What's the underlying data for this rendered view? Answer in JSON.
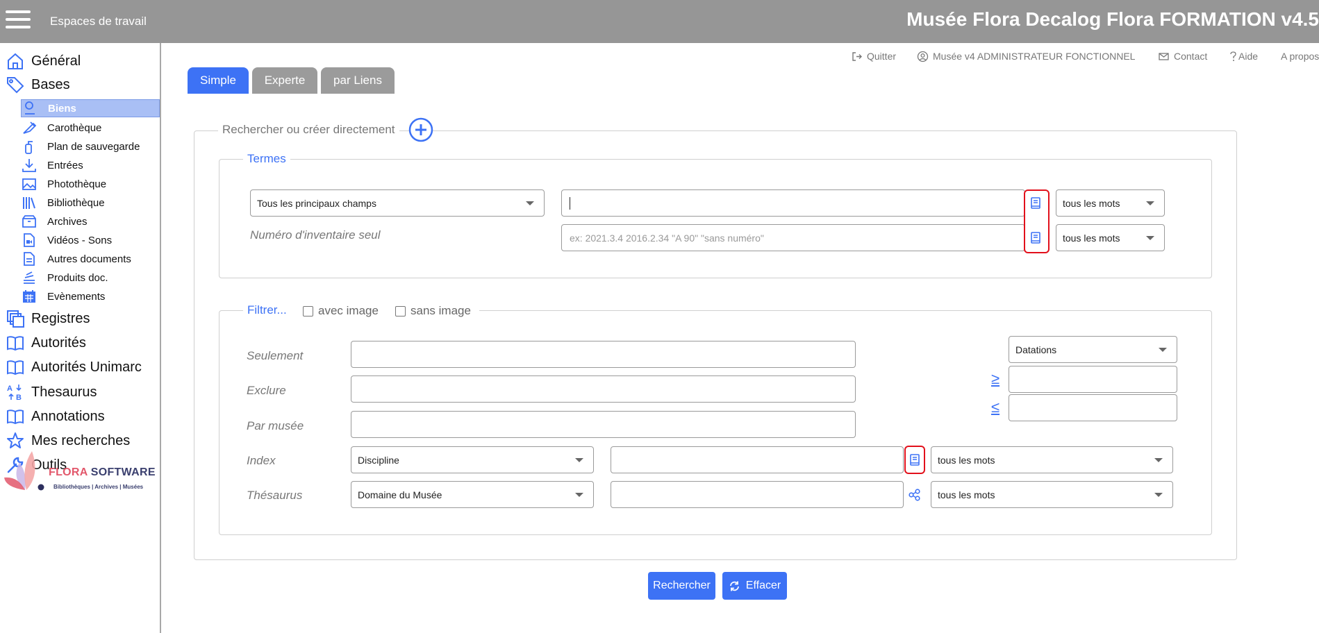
{
  "topbar": {
    "workspaces_label": "Espaces de travail",
    "title": "Musée Flora Decalog Flora FORMATION v4.5"
  },
  "header_links": {
    "quit": "Quitter",
    "user": "Musée v4 ADMINISTRATEUR FONCTIONNEL",
    "contact": "Contact",
    "help": "Aide",
    "about": "A propos"
  },
  "sidebar": {
    "general": "Général",
    "bases": "Bases",
    "sub_items": [
      "Biens",
      "Carothèque",
      "Plan de sauvegarde",
      "Entrées",
      "Photothèque",
      "Bibliothèque",
      "Archives",
      "Vidéos - Sons",
      "Autres documents",
      "Produits doc.",
      "Evènements"
    ],
    "main_items": [
      "Registres",
      "Autorités",
      "Autorités Unimarc",
      "Thesaurus",
      "Annotations",
      "Mes recherches",
      "Outils"
    ],
    "logo_flora": "FLORA",
    "logo_software": "SOFTWARE",
    "logo_tagline": "Bibliothèques | Archives | Musées"
  },
  "tabs": [
    "Simple",
    "Experte",
    "par Liens"
  ],
  "search": {
    "legend": "Rechercher ou créer directement",
    "terms_legend": "Termes",
    "field_select": "Tous les principaux champs",
    "inventory_label": "Numéro d'inventaire seul",
    "inventory_placeholder": "ex: 2021.3.4 2016.2.34 \"A 90\" \"sans numéro\"",
    "mode_1": "tous les mots",
    "mode_2": "tous les mots"
  },
  "filter": {
    "legend": "Filtrer...",
    "with_image": "avec image",
    "without_image": "sans image",
    "only_label": "Seulement",
    "exclude_label": "Exclure",
    "museum_label": "Par musée",
    "index_label": "Index",
    "thesaurus_label": "Thésaurus",
    "index_select": "Discipline",
    "thesaurus_select": "Domaine du Musée",
    "index_mode": "tous les mots",
    "thesaurus_mode": "tous les mots",
    "date_select": "Datations",
    "gte": "≥",
    "lte": "≤"
  },
  "actions": {
    "search": "Rechercher",
    "clear": "Effacer"
  },
  "colors": {
    "accent": "#3d72f5",
    "topbar": "#969696",
    "highlight": "#e2101b"
  }
}
